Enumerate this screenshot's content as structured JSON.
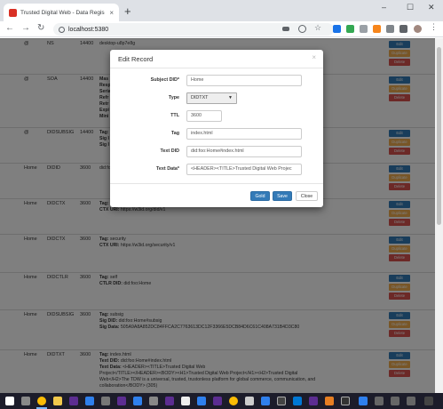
{
  "browser": {
    "tab_title": "Trusted Digital Web - Data Regis",
    "tab_close": "×",
    "new_tab": "+",
    "url": "localhost:5380",
    "win_min": "–",
    "win_max": "☐",
    "win_close": "✕"
  },
  "table": {
    "rows": [
      {
        "subject": "@",
        "type": "NS",
        "ttl": "14400",
        "detail_lines": [
          {
            "bold": "",
            "text": "desktop-u8p7e8g"
          }
        ]
      },
      {
        "subject": "@",
        "type": "SOA",
        "ttl": "14400",
        "detail_lines": [
          {
            "bold": "Mas",
            "text": ""
          },
          {
            "bold": "Resp",
            "text": ""
          },
          {
            "bold": "Seria",
            "text": ""
          },
          {
            "bold": "Refr",
            "text": ""
          },
          {
            "bold": "Retr",
            "text": ""
          },
          {
            "bold": "Expi",
            "text": ""
          },
          {
            "bold": "Mini",
            "text": ""
          }
        ]
      },
      {
        "subject": "@",
        "type": "DIDSUBSIG",
        "ttl": "14400",
        "detail_lines": [
          {
            "bold": "Tag:",
            "text": ""
          },
          {
            "bold": "Sig I",
            "text": ""
          },
          {
            "bold": "Sig I",
            "text": ""
          }
        ]
      },
      {
        "subject": "Home",
        "type": "DIDID",
        "ttl": "3600",
        "detail_lines": [
          {
            "bold": "",
            "text": "did:foo"
          }
        ]
      },
      {
        "subject": "Home",
        "type": "DIDCTX",
        "ttl": "3600",
        "detail_lines": [
          {
            "bold": "Tag:",
            "text": ""
          },
          {
            "bold": "CTX URI:",
            "text": " https://w3id.org/did/v1"
          }
        ]
      },
      {
        "subject": "Home",
        "type": "DIDCTX",
        "ttl": "3600",
        "detail_lines": [
          {
            "bold": "Tag:",
            "text": " security"
          },
          {
            "bold": "CTX URI:",
            "text": " https://w3id.org/security/v1"
          }
        ]
      },
      {
        "subject": "Home",
        "type": "DIDCTLR",
        "ttl": "3600",
        "detail_lines": [
          {
            "bold": "Tag:",
            "text": " self"
          },
          {
            "bold": "CTLR DID:",
            "text": " did:foo:Home"
          }
        ]
      },
      {
        "subject": "Home",
        "type": "DIDSUBSIG",
        "ttl": "3600",
        "detail_lines": [
          {
            "bold": "Tag:",
            "text": " subsig"
          },
          {
            "bold": "Sig DID:",
            "text": " did:foo:Home#subsig"
          },
          {
            "bold": "Sig Data:",
            "text": " 505A9A8A852DC84FFCA2C7763613DC12F3366E5DCB84D6C61C408A731B4D3C80"
          }
        ]
      },
      {
        "subject": "Home",
        "type": "DIDTXT",
        "ttl": "3600",
        "detail_lines": [
          {
            "bold": "Tag:",
            "text": " index.html"
          },
          {
            "bold": "Text DID:",
            "text": " did:foo:Home#index.html"
          },
          {
            "bold": "Text Data:",
            "text": " &lt;HEADER&gt;&lt;TITLE&gt;Trusted Digital Web"
          },
          {
            "bold": "",
            "text": "Project&lt;/TITLE&gt;&lt;/HEADER&gt;&lt;BODY&gt;&lt;H1&gt;Trusted Digital Web Project&lt;/H1&gt;&lt;H2&gt;Trusted Digital"
          },
          {
            "bold": "",
            "text": "Web&lt;/H2&gt;The TDW is a universal, trusted, trustonless platform for global commerce, communication, and"
          },
          {
            "bold": "",
            "text": "collaboration&lt;/BODY&gt; (305)"
          }
        ]
      }
    ],
    "edit_label": "Edit",
    "duplicate_label": "Duplicate",
    "delete_label": "Delete"
  },
  "modal": {
    "title": "Edit Record",
    "close": "×",
    "fields": {
      "subject_label": "Subject DID*",
      "subject_value": "Home",
      "type_label": "Type",
      "type_value": "DIDTXT",
      "ttl_label": "TTL",
      "ttl_value": "3600",
      "tag_label": "Tag",
      "tag_value": "index.html",
      "text_did_label": "Text DID",
      "text_did_value": "did:foo:Home#index.html",
      "text_data_label": "Text Data*",
      "text_data_value": "<HEADER><TITLE>Trusted Digital Web Projec"
    },
    "buttons": {
      "gold": "Gold",
      "save": "Save",
      "close": "Close"
    }
  },
  "colors": {
    "primary": "#337ab7",
    "warning": "#f0ad4e",
    "danger": "#d9534f"
  }
}
